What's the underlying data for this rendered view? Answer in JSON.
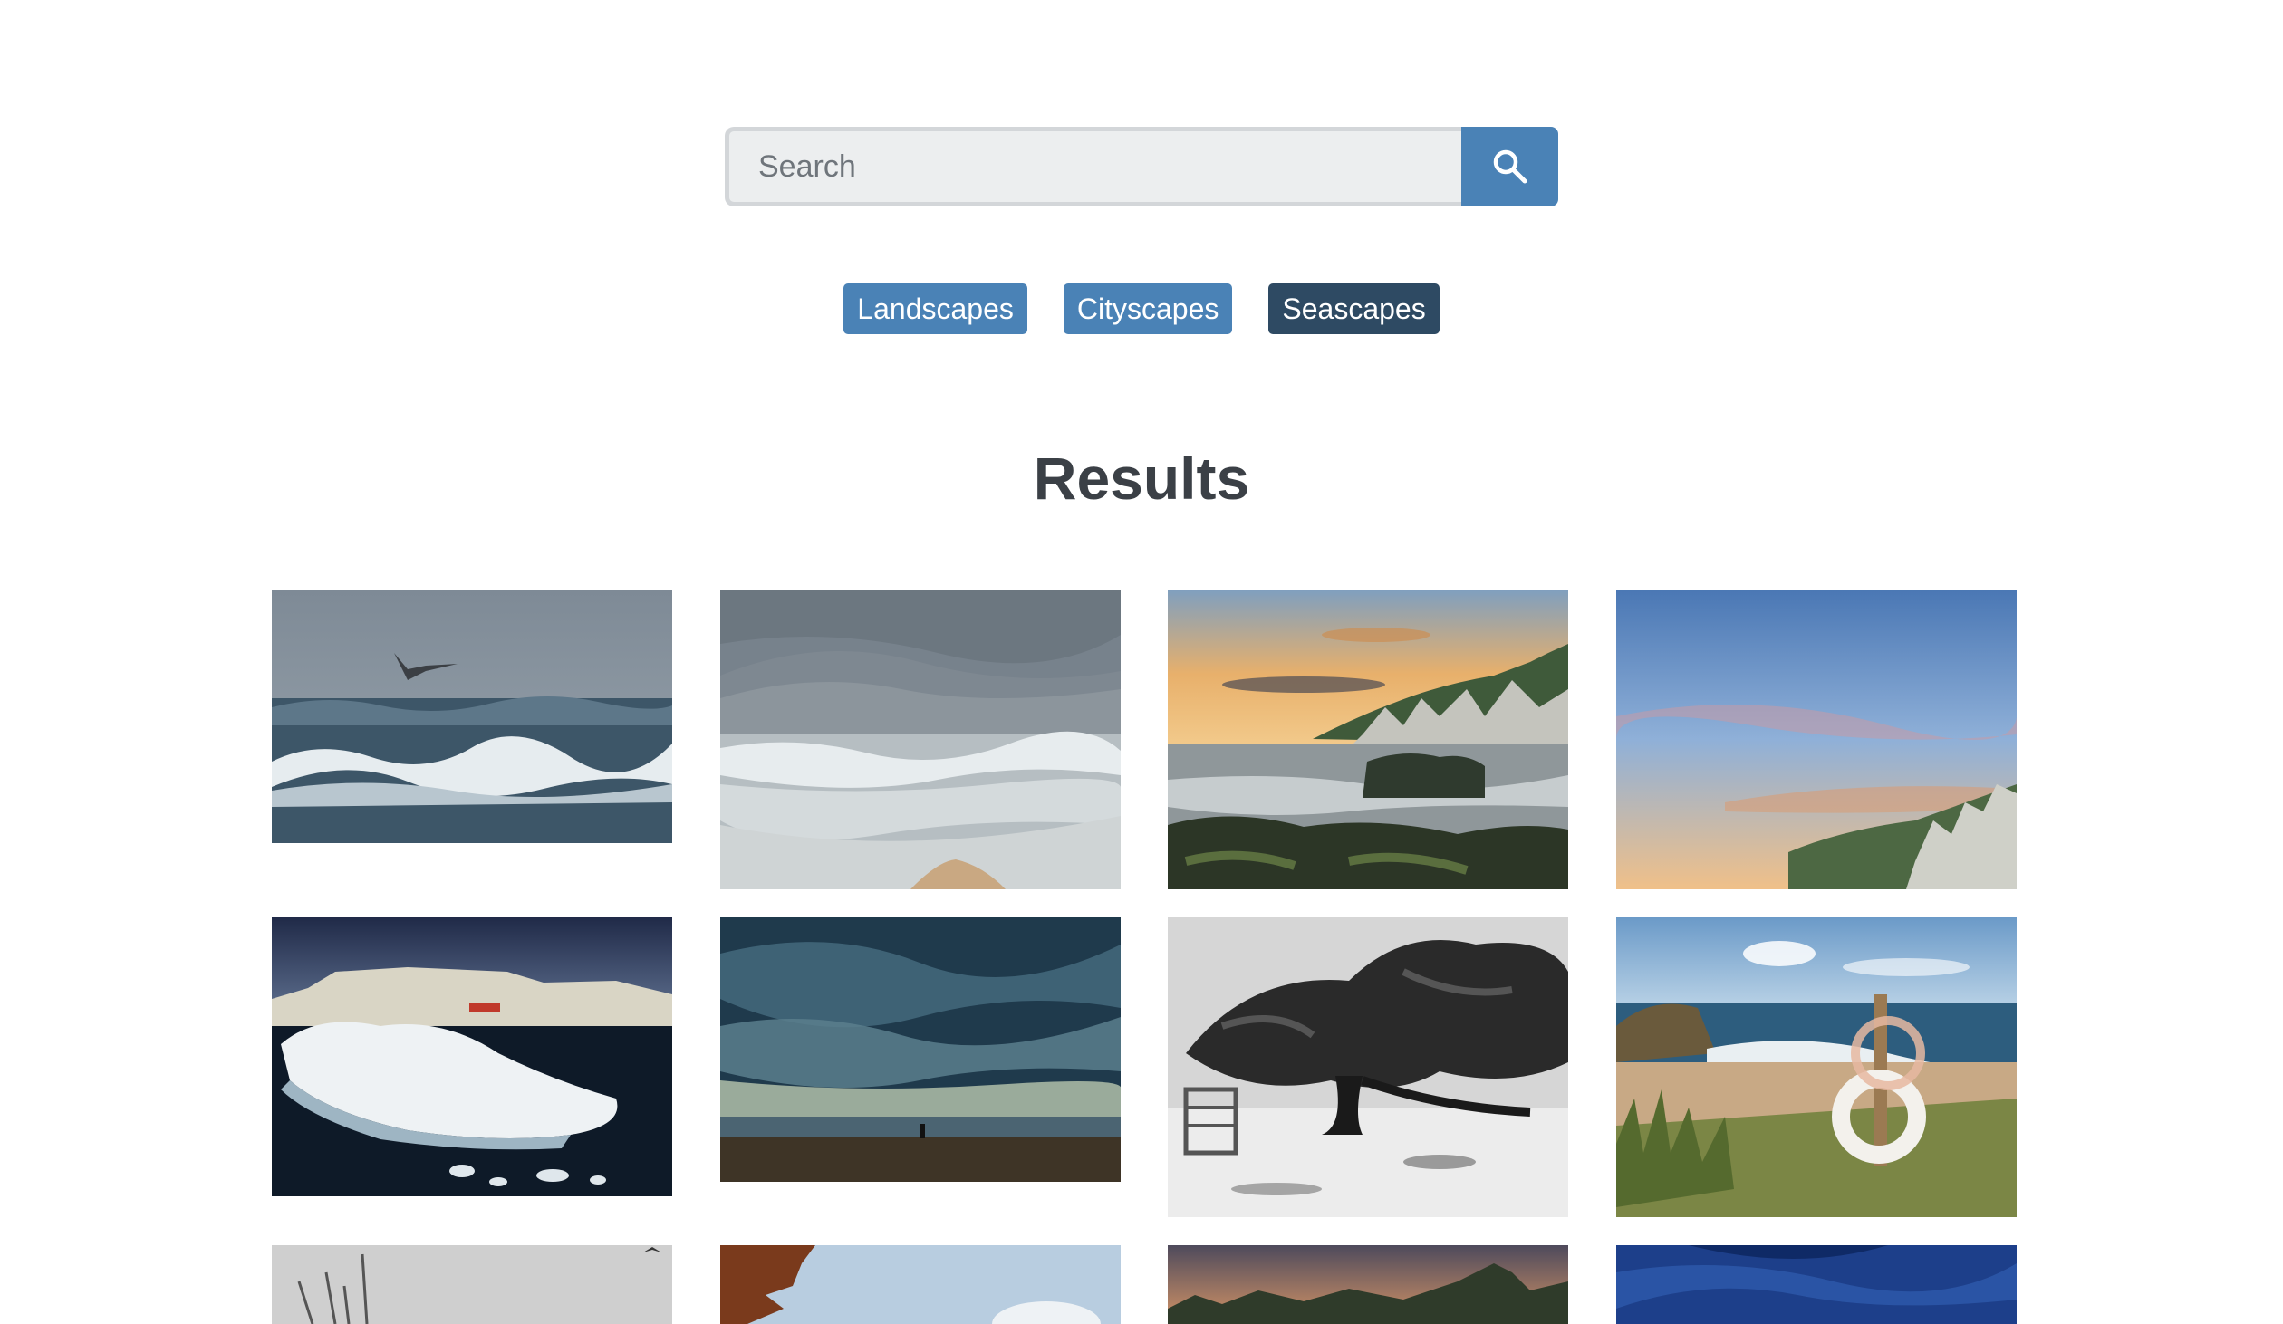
{
  "search": {
    "placeholder": "Search",
    "value": ""
  },
  "icons": {
    "search_button": "search-icon"
  },
  "tags": [
    {
      "label": "Landscapes",
      "active": false
    },
    {
      "label": "Cityscapes",
      "active": false
    },
    {
      "label": "Seascapes",
      "active": true
    }
  ],
  "results": {
    "title": "Results"
  },
  "colors": {
    "accent": "#4a82b6",
    "active_tag": "#2e4a63",
    "heading": "#3b4046",
    "search_background": "#eceeef"
  }
}
